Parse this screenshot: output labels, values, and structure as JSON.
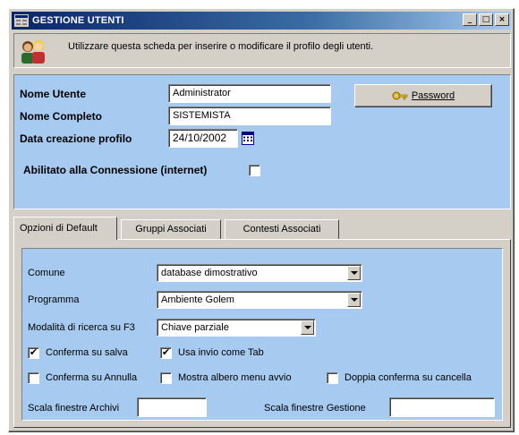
{
  "window": {
    "title": "GESTIONE UTENTI",
    "controls": {
      "minimize": "_",
      "maximize": "□",
      "close": "×"
    }
  },
  "info": {
    "text": "Utilizzare questa scheda per inserire o modificare il profilo degli utenti."
  },
  "user": {
    "nome_utente_label": "Nome Utente",
    "nome_utente_value": "Administrator",
    "nome_completo_label": "Nome Completo",
    "nome_completo_value": "SISTEMISTA",
    "data_label": "Data creazione profilo",
    "data_value": "24/10/2002",
    "abilitato_label": "Abilitato alla Connessione (internet)",
    "abilitato_checked": false,
    "password_button": "Password"
  },
  "tabs": [
    {
      "label": "Opzioni di Default",
      "active": true
    },
    {
      "label": "Gruppi Associati",
      "active": false
    },
    {
      "label": "Contesti Associati",
      "active": false
    }
  ],
  "options": {
    "comune_label": "Comune",
    "comune_value": "database dimostrativo",
    "programma_label": "Programma",
    "programma_value": "Ambiente Golem",
    "ricerca_label": "Modalità di ricerca su F3",
    "ricerca_value": "Chiave parziale",
    "conferma_salva_label": "Conferma su salva",
    "conferma_salva_checked": "✔",
    "usa_invio_label": "Usa invio come Tab",
    "usa_invio_checked": "✔",
    "conferma_annulla_label": "Conferma su Annulla",
    "mostra_albero_label": "Mostra albero menu avvio",
    "doppia_conferma_label": "Doppia conferma su cancella",
    "scala_archivi_label": "Scala finestre Archivi",
    "scala_archivi_value": "",
    "scala_gestione_label": "Scala finestre Gestione",
    "scala_gestione_value": ""
  },
  "colors": {
    "panel_blue": "#a6caf0",
    "face": "#d4d0c8",
    "title_start": "#0a246a"
  },
  "icons": [
    "app-icon",
    "users-icon",
    "key-icon",
    "calendar-icon",
    "dropdown-arrow-icon",
    "checkmark-icon"
  ]
}
